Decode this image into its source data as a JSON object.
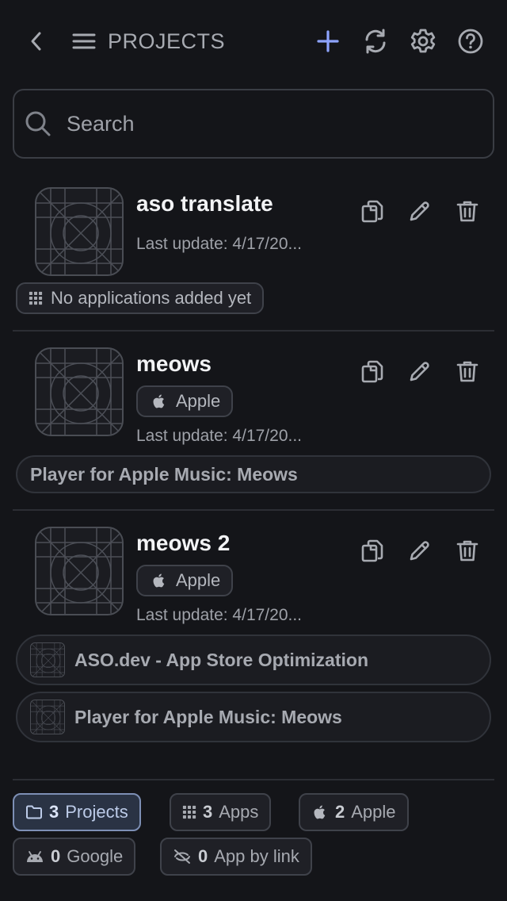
{
  "header": {
    "title": "PROJECTS",
    "icons": [
      "back-icon",
      "menu-icon",
      "add-icon",
      "sync-icon",
      "gear-icon",
      "help-icon"
    ],
    "accent": "#8ea4ff"
  },
  "search": {
    "placeholder": "Search",
    "value": ""
  },
  "projects": [
    {
      "name": "aso translate",
      "platform": "",
      "last_update": "Last update: 4/17/20...",
      "apps_empty": "No applications added yet",
      "apps": []
    },
    {
      "name": "meows",
      "platform": "Apple",
      "last_update": "Last update: 4/17/20...",
      "apps": [
        "Player for Apple Music: Meows"
      ]
    },
    {
      "name": "meows 2",
      "platform": "Apple",
      "last_update": "Last update: 4/17/20...",
      "apps": [
        "ASO.dev - App Store Optimization",
        "Player for Apple Music: Meows"
      ]
    }
  ],
  "stats": [
    {
      "count": "3",
      "label": "Projects",
      "icon": "folder-icon",
      "active": true
    },
    {
      "count": "3",
      "label": "Apps",
      "icon": "grid-icon",
      "active": false
    },
    {
      "count": "2",
      "label": "Apple",
      "icon": "apple-icon",
      "active": false
    },
    {
      "count": "0",
      "label": "Google",
      "icon": "android-icon",
      "active": false
    },
    {
      "count": "0",
      "label": "App by link",
      "icon": "link-off-icon",
      "active": false
    }
  ]
}
